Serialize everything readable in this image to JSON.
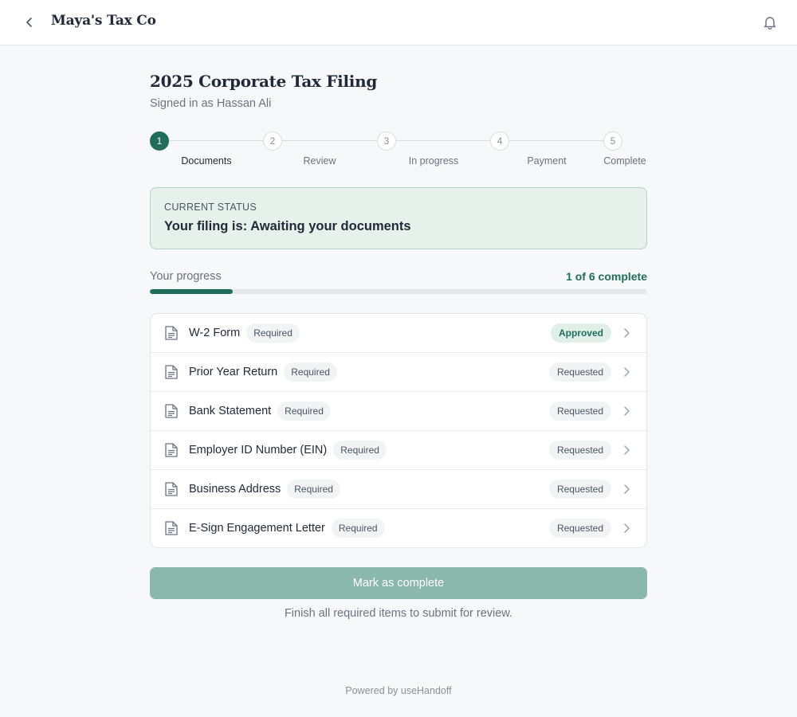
{
  "header": {
    "brand": "Maya's Tax Co",
    "back_icon": "chevron-left-icon",
    "notifications_icon": "bell-icon"
  },
  "page": {
    "title": "2025 Corporate Tax Filing",
    "signed_in": "Signed in as Hassan Ali"
  },
  "steps": [
    {
      "number": "1",
      "label": "Documents",
      "active": true
    },
    {
      "number": "2",
      "label": "Review",
      "active": false
    },
    {
      "number": "3",
      "label": "In progress",
      "active": false
    },
    {
      "number": "4",
      "label": "Payment",
      "active": false
    },
    {
      "number": "5",
      "label": "Complete",
      "active": false
    }
  ],
  "status": {
    "eyebrow": "CURRENT STATUS",
    "text": "Your filing is: Awaiting your documents"
  },
  "progress": {
    "label": "Your progress",
    "count_text": "1 of 6 complete",
    "completed": 1,
    "total": 6
  },
  "documents": [
    {
      "name": "W-2 Form",
      "requirement": "Required",
      "status": "Approved"
    },
    {
      "name": "Prior Year Return",
      "requirement": "Required",
      "status": "Requested"
    },
    {
      "name": "Bank Statement",
      "requirement": "Required",
      "status": "Requested"
    },
    {
      "name": "Employer ID Number (EIN)",
      "requirement": "Required",
      "status": "Requested"
    },
    {
      "name": "Business Address",
      "requirement": "Required",
      "status": "Requested"
    },
    {
      "name": "E-Sign Engagement Letter",
      "requirement": "Required",
      "status": "Requested"
    }
  ],
  "actions": {
    "complete_label": "Mark as complete",
    "helper": "Finish all required items to submit for review."
  },
  "footer": {
    "text": "Powered by useHandoff"
  },
  "colors": {
    "accent": "#1f6e59",
    "status_bg": "#e6f1ec",
    "button_disabled": "#8ab8aa"
  }
}
